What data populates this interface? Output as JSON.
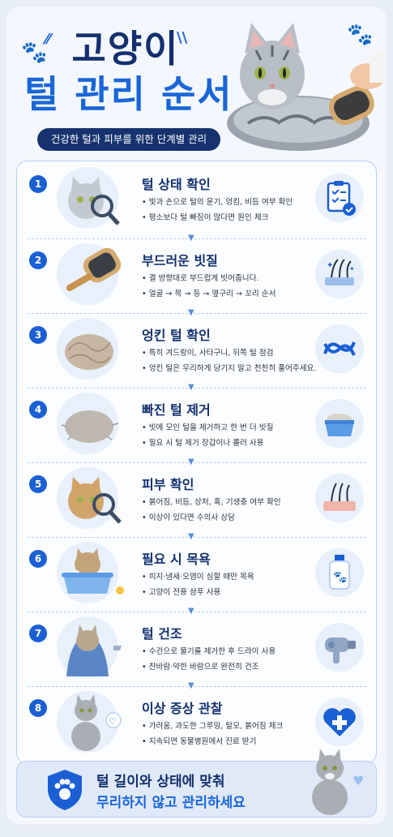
{
  "header": {
    "title_line1": "고양이",
    "title_line2": "털 관리 순서",
    "subtitle": "건강한 털과 피부를 위한 단계별 관리"
  },
  "steps": [
    {
      "number": "1",
      "title": "털 상태 확인",
      "bullets": [
        "빛과 손으로 털의 윤기, 엉킴, 비듬 여부 확인",
        "평소보다 털 빠짐이 많다면 원인 체크"
      ],
      "icon": "clipboard-check-icon"
    },
    {
      "number": "2",
      "title": "부드러운 빗질",
      "bullets": [
        "결 방향대로 부드럽게 빗어줍니다.",
        "얼굴 → 목 → 등 → 옆구리 → 꼬리 순서"
      ],
      "icon": "skin-hair-sparkle-icon"
    },
    {
      "number": "3",
      "title": "엉킨 털 확인",
      "bullets": [
        "특히 겨드랑이, 사타구니, 뒤쪽 털 점검",
        "엉킨 털은 무리하게 당기지 말고 천천히 풀어주세요."
      ],
      "icon": "knot-icon"
    },
    {
      "number": "4",
      "title": "빠진 털 제거",
      "bullets": [
        "빗에 모인 털을 제거하고 한 번 더 빗질",
        "필요 시 털 제거 장갑이나 롤러 사용"
      ],
      "icon": "fur-bowl-icon"
    },
    {
      "number": "5",
      "title": "피부 확인",
      "bullets": [
        "붉어짐, 비듬, 상처, 혹, 기생충 여부 확인",
        "이상이 있다면 수의사 상담"
      ],
      "icon": "skin-hair-icon"
    },
    {
      "number": "6",
      "title": "필요 시 목욕",
      "bullets": [
        "피지·냄새·오염이 심할 때만 목욕",
        "고양이 전용 샴푸 사용"
      ],
      "icon": "shampoo-bottle-icon"
    },
    {
      "number": "7",
      "title": "털 건조",
      "bullets": [
        "수건으로 물기를 제거한 후 드라이 사용",
        "찬바람·약한 바람으로 완전히 건조"
      ],
      "icon": "hair-dryer-icon"
    },
    {
      "number": "8",
      "title": "이상 증상 관찰",
      "bullets": [
        "가려움, 과도한 그루밍, 탈모, 붉어짐 체크",
        "지속되면 동물병원에서 진료 받기"
      ],
      "icon": "health-heart-icon"
    }
  ],
  "footer": {
    "line1": "털 길이와 상태에 맞춰",
    "line2": "무리하지 않고 관리하세요"
  },
  "colors": {
    "navy": "#13306e",
    "blue": "#1a66d8",
    "light": "#e8f0fb"
  }
}
